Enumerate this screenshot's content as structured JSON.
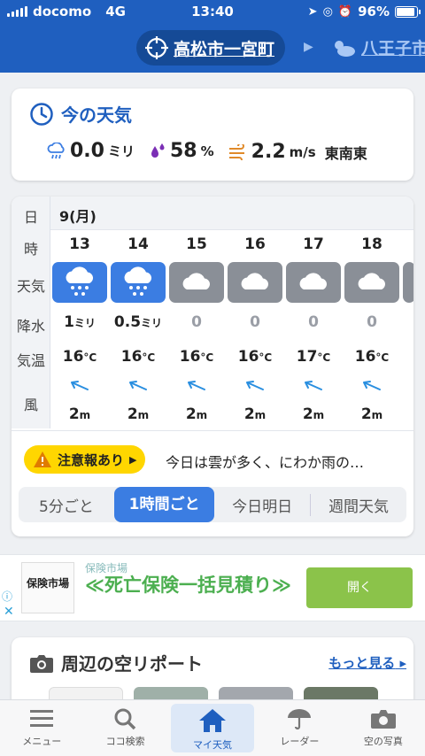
{
  "status_bar": {
    "carrier": "docomo",
    "network": "4G",
    "time": "13:40",
    "battery": "96%"
  },
  "location": {
    "current": "高松市一宮町",
    "next": "八王子市"
  },
  "now": {
    "title": "今の天気",
    "precip_value": "0.0",
    "precip_unit": "ミリ",
    "humidity_value": "58",
    "humidity_unit": "%",
    "wind_value": "2.2",
    "wind_unit": "m/s",
    "wind_dir": "東南東"
  },
  "hourly": {
    "labels": {
      "day": "日",
      "hour": "時",
      "weather": "天気",
      "precip": "降水",
      "temp": "気温",
      "wind": "風"
    },
    "date": "9(月)",
    "hours": [
      {
        "hour": "13",
        "weather": "rain-icon",
        "precip": "1",
        "precip_unit": "ミリ",
        "temp": "16",
        "temp_unit": "°C",
        "wind": "2",
        "wind_unit": "m"
      },
      {
        "hour": "14",
        "weather": "rain-icon",
        "precip": "0.5",
        "precip_unit": "ミリ",
        "temp": "16",
        "temp_unit": "°C",
        "wind": "2",
        "wind_unit": "m"
      },
      {
        "hour": "15",
        "weather": "cloud-icon",
        "precip": "0",
        "precip_unit": "",
        "temp": "16",
        "temp_unit": "°C",
        "wind": "2",
        "wind_unit": "m"
      },
      {
        "hour": "16",
        "weather": "cloud-icon",
        "precip": "0",
        "precip_unit": "",
        "temp": "16",
        "temp_unit": "°C",
        "wind": "2",
        "wind_unit": "m"
      },
      {
        "hour": "17",
        "weather": "cloud-icon",
        "precip": "0",
        "precip_unit": "",
        "temp": "17",
        "temp_unit": "°C",
        "wind": "2",
        "wind_unit": "m"
      },
      {
        "hour": "18",
        "weather": "cloud-icon",
        "precip": "0",
        "precip_unit": "",
        "temp": "16",
        "temp_unit": "°C",
        "wind": "2",
        "wind_unit": "m"
      }
    ]
  },
  "warning": {
    "badge": "注意報あり",
    "text": "今日は雲が多く、にわか雨の…"
  },
  "segments": [
    "5分ごと",
    "1時間ごと",
    "今日明日",
    "週間天気"
  ],
  "ad": {
    "logo": "保険市場",
    "source": "保険市場",
    "headline": "≪死亡保険一括見積り≫",
    "button": "開く"
  },
  "sky": {
    "title": "周辺の空リポート",
    "more": "もっと見る"
  },
  "tabs": [
    "メニュー",
    "ココ検索",
    "マイ天気",
    "レーダー",
    "空の写真"
  ],
  "colors": {
    "brand": "#1f5fbf",
    "rain_tile": "#3b7de2",
    "cloud_tile": "#8a8f97",
    "warning": "#ffd600",
    "ad_green": "#8bc34a"
  }
}
